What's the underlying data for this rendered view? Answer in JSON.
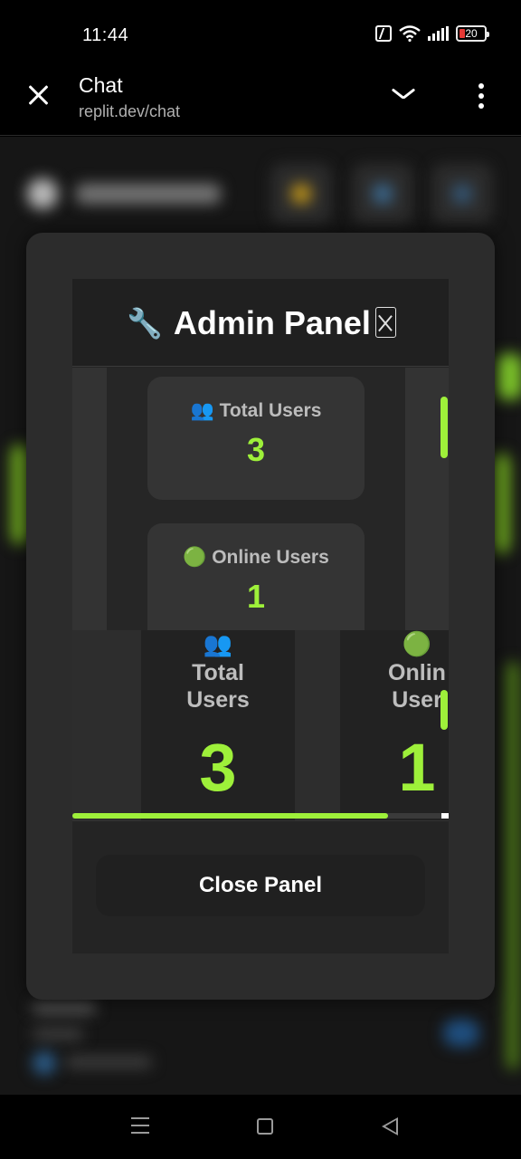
{
  "status_bar": {
    "time": "11:44",
    "battery": "20"
  },
  "browser": {
    "title": "Chat",
    "url": "replit.dev/chat"
  },
  "admin_panel": {
    "title": "Admin Panel",
    "wrench_emoji": "🔧",
    "stats": [
      {
        "emoji": "👥",
        "label": "Total Users",
        "value": "3"
      },
      {
        "emoji": "🟢",
        "label": "Online Users",
        "value": "1"
      }
    ],
    "zoomed_stats": [
      {
        "emoji": "👥",
        "label_line1": "Total",
        "label_line2": "Users",
        "value": "3"
      },
      {
        "emoji": "🟢",
        "label_line1": "Onlin",
        "label_line2": "User",
        "value": "1"
      }
    ],
    "close_button_label": "Close Panel"
  },
  "colors": {
    "accent": "#9ef03a",
    "modal_bg": "#2c2c2c",
    "panel_bg": "#242424"
  }
}
